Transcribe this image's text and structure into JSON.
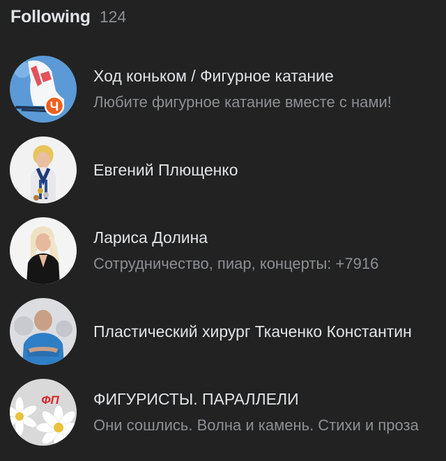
{
  "header": {
    "title": "Following",
    "count": "124"
  },
  "items": [
    {
      "name": "Ход коньком / Фигурное катание",
      "description": "Любите фигурное катание вместе с нами!",
      "avatar_icon": "figure-skate-avatar",
      "badge_text": "Ч"
    },
    {
      "name": "Евгений Плющенко",
      "description": "",
      "avatar_icon": "person-avatar"
    },
    {
      "name": "Лариса Долина",
      "description": "Сотрудничество, пиар, концерты: +7916",
      "avatar_icon": "person-avatar"
    },
    {
      "name": "Пластический хирург Ткаченко Константин",
      "description": "",
      "avatar_icon": "person-avatar"
    },
    {
      "name": "ФИГУРИСТЫ. ПАРАЛЛЕЛИ",
      "description": "Они сошлись. Волна и камень. Стихи и проза",
      "avatar_icon": "daisy-avatar",
      "logo_text": "ФП"
    }
  ],
  "colors": {
    "background": "#222222",
    "text_primary": "#e1e3e6",
    "text_secondary": "#8d8f93",
    "badge": "#f05f1e"
  }
}
